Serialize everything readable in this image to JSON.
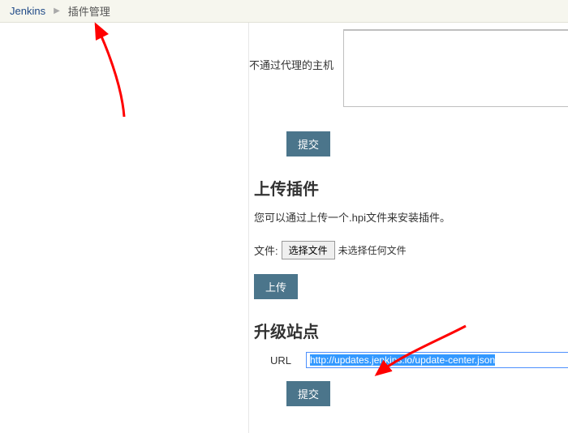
{
  "breadcrumb": {
    "root": "Jenkins",
    "current": "插件管理"
  },
  "noProxy": {
    "label": "不通过代理的主机"
  },
  "buttons": {
    "submit": "提交",
    "upload": "上传"
  },
  "uploadPlugin": {
    "title": "上传插件",
    "desc": "您可以通过上传一个.hpi文件来安装插件。",
    "fileLabel": "文件:",
    "chooseFile": "选择文件",
    "noFile": "未选择任何文件"
  },
  "updateSite": {
    "title": "升级站点",
    "urlLabel": "URL",
    "urlValue": "http://updates.jenkins.io/update-center.json"
  }
}
